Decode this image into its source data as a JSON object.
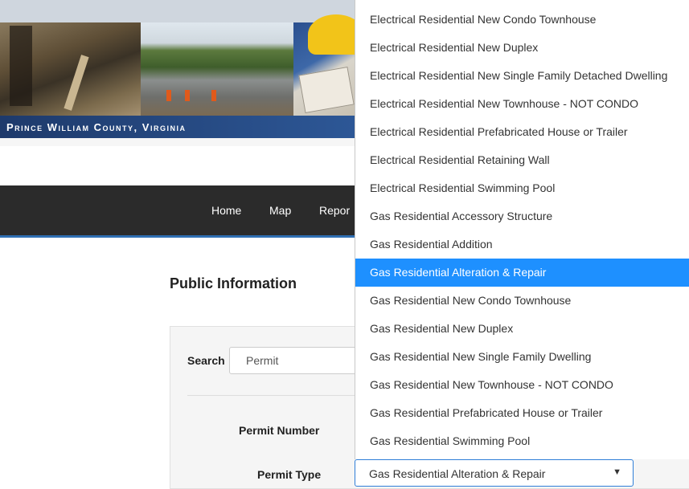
{
  "banner": {
    "county_text": "Prince William County, Virginia"
  },
  "nav": {
    "items": [
      "Home",
      "Map",
      "Repor"
    ]
  },
  "page": {
    "title": "Public Information"
  },
  "search": {
    "label": "Search",
    "value": "Permit"
  },
  "fields": {
    "permit_number_label": "Permit Number",
    "permit_type_label": "Permit Type"
  },
  "permit_type_select": {
    "value": "Gas Residential Alteration & Repair"
  },
  "dropdown": {
    "selected_index": 9,
    "options": [
      "Electrical Residential New Condo Townhouse",
      "Electrical Residential New Duplex",
      "Electrical Residential New Single Family Detached Dwelling",
      "Electrical Residential New Townhouse - NOT CONDO",
      "Electrical Residential Prefabricated House or Trailer",
      "Electrical Residential Retaining Wall",
      "Electrical Residential Swimming Pool",
      "Gas Residential Accessory Structure",
      "Gas Residential Addition",
      "Gas Residential Alteration & Repair",
      "Gas Residential New Condo Townhouse",
      "Gas Residential New Duplex",
      "Gas Residential New Single Family Dwelling",
      "Gas Residential New Townhouse - NOT CONDO",
      "Gas Residential Prefabricated House or Trailer",
      "Gas Residential Swimming Pool"
    ]
  },
  "colors": {
    "accent": "#1e90ff",
    "navbar": "#2b2b2b",
    "banner_bar": "#1e3a6b"
  }
}
